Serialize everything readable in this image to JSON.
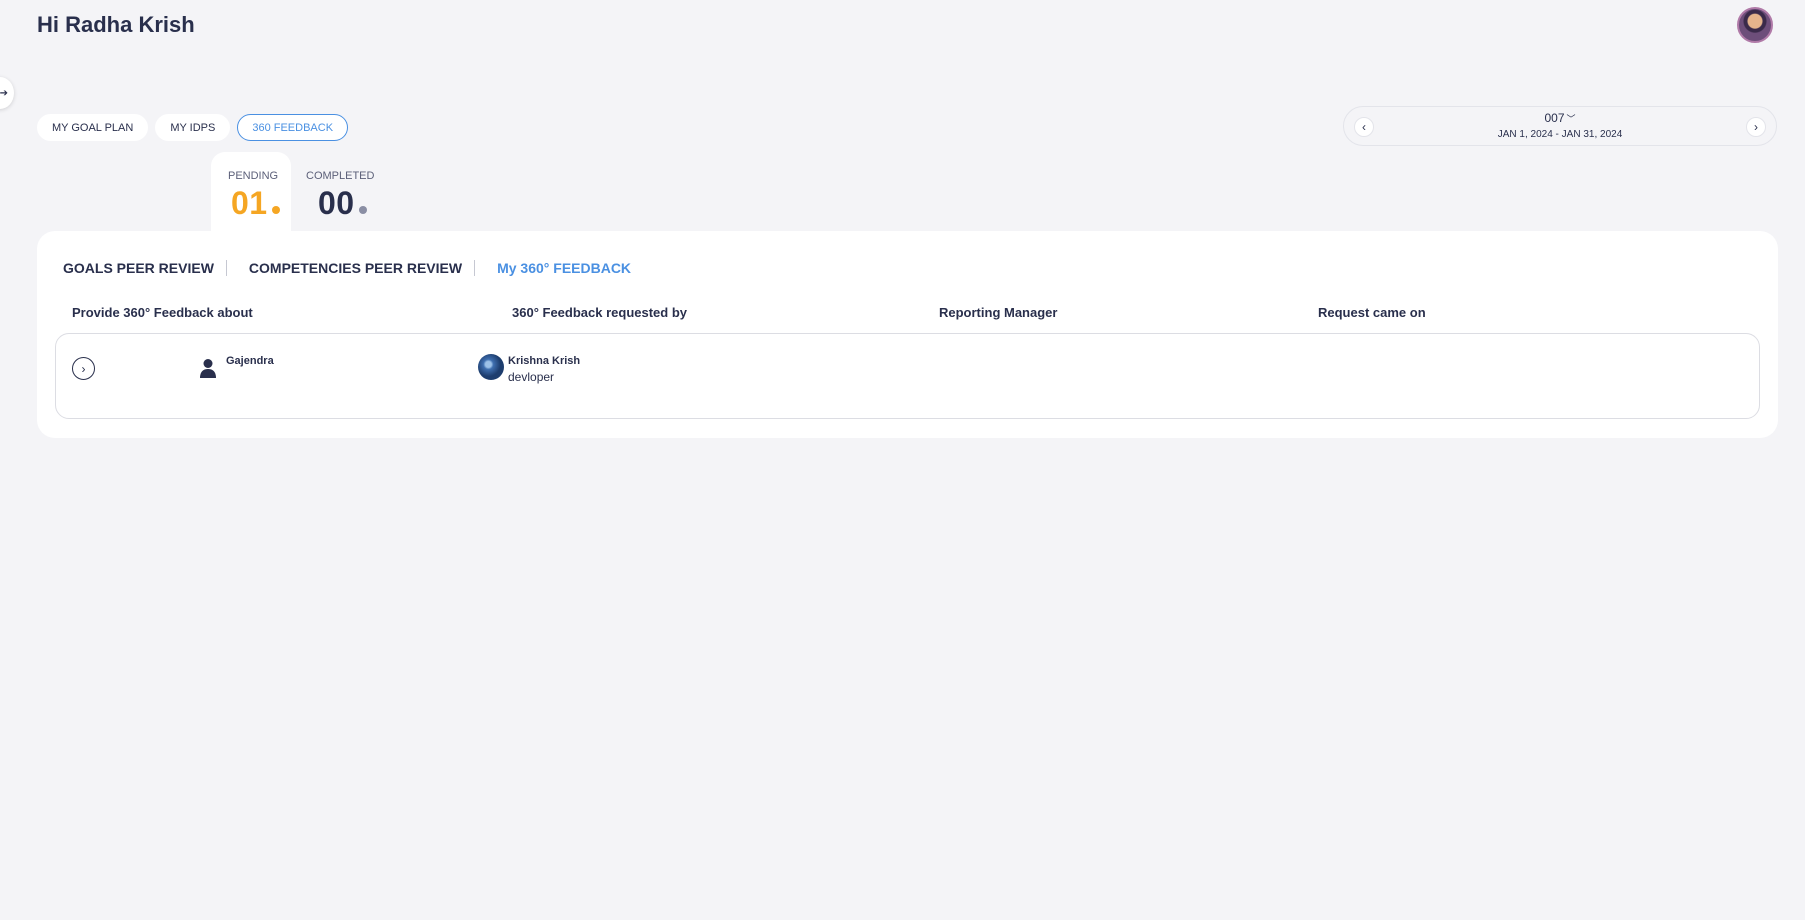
{
  "header": {
    "greeting": "Hi Radha Krish"
  },
  "pills": [
    "MY GOAL PLAN",
    "MY IDPS",
    "360 FEEDBACK"
  ],
  "period": {
    "cycle": "007",
    "range": "JAN 1, 2024 - JAN 31, 2024"
  },
  "stats": {
    "pending_label": "PENDING",
    "pending_value": "01",
    "completed_label": "COMPLETED",
    "completed_value": "00"
  },
  "subtabs": [
    "GOALS PEER REVIEW",
    "COMPETENCIES PEER REVIEW",
    "My 360° FEEDBACK"
  ],
  "table": {
    "headers": [
      "Provide 360° Feedback about",
      "360° Feedback requested by",
      "Reporting Manager",
      "Request came on"
    ],
    "rows": [
      {
        "about_name": "Gajendra",
        "requested_by_name": "Krishna Krish",
        "requested_by_role": "devloper"
      }
    ]
  },
  "colors": {
    "accent": "#4a90e2",
    "pending": "#f5a623",
    "text": "#292f4c"
  }
}
